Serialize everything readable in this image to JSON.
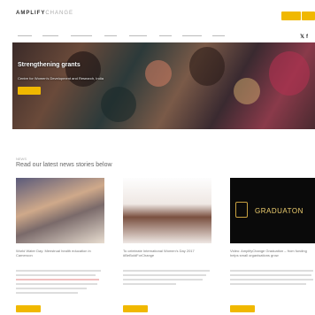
{
  "header": {
    "logo_bold": "AMPLIFY",
    "logo_light": "CHANGE",
    "social_icons": [
      "twitter-icon",
      "facebook-icon"
    ]
  },
  "hero": {
    "title": "Strengthening grants",
    "subtitle": "Centre for Women's Development and Research, India"
  },
  "news": {
    "section_label": "NEWS",
    "heading": "Read our latest news stories below",
    "graduation_text": "GRADUATON",
    "cards": [
      {
        "title": "World Water Day: Menstrual health education in Cameroon"
      },
      {
        "title": "To celebrate International Women's Day 2017 #BeBoldForChange"
      },
      {
        "title": "Video: AmplifyChange Graduation – from funding helps small organisations grow"
      }
    ]
  },
  "colors": {
    "accent": "#f0b800"
  }
}
